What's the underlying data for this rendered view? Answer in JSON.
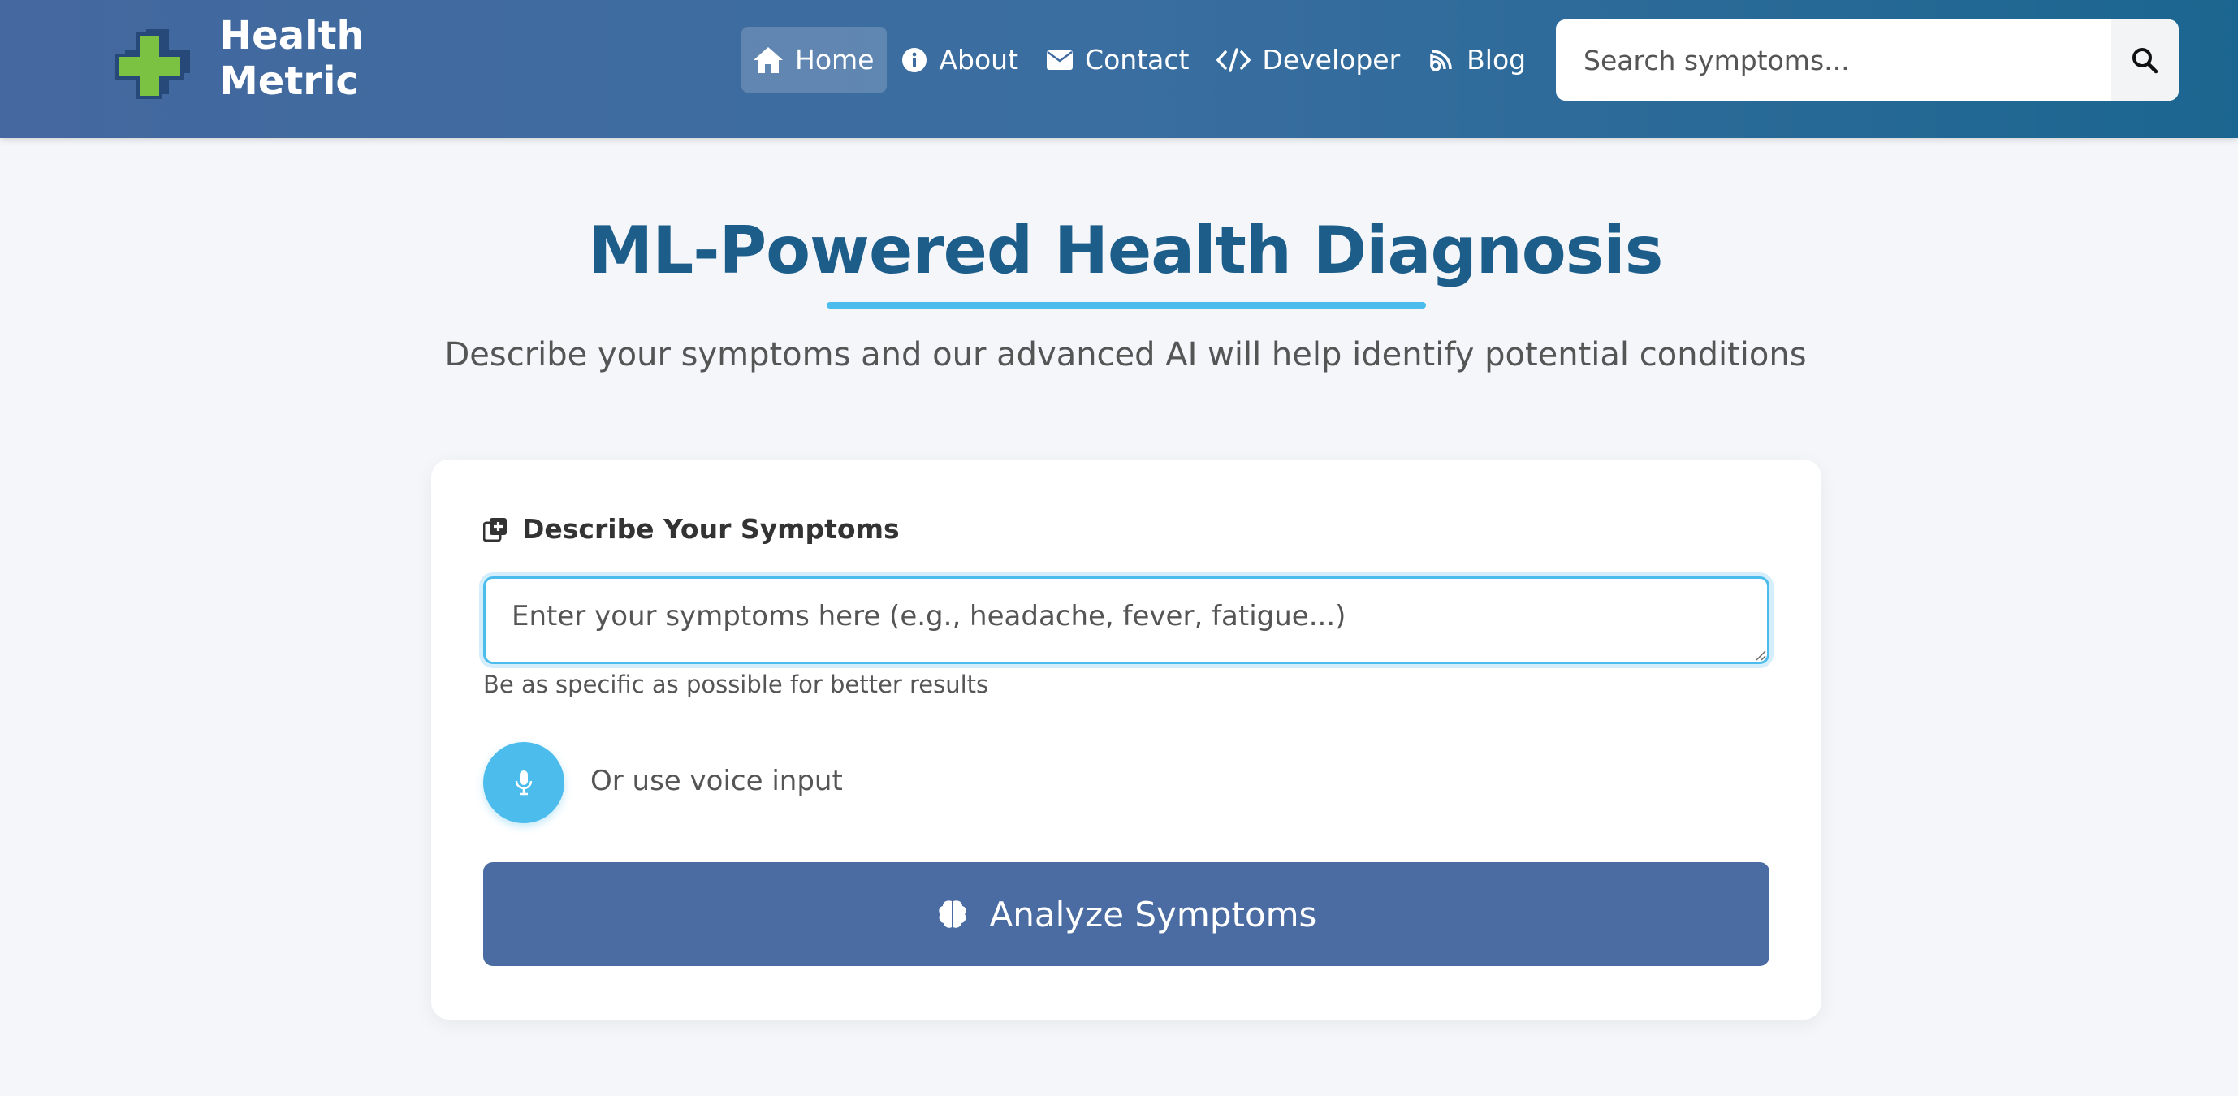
{
  "header": {
    "brand_line1": "Health",
    "brand_line2": "Metric",
    "nav": [
      {
        "label": "Home",
        "icon": "home-icon",
        "active": true
      },
      {
        "label": "About",
        "icon": "info-icon"
      },
      {
        "label": "Contact",
        "icon": "envelope-icon"
      },
      {
        "label": "Developer",
        "icon": "code-icon"
      },
      {
        "label": "Blog",
        "icon": "blog-icon"
      }
    ],
    "search": {
      "placeholder": "Search symptoms...",
      "icon": "search-icon"
    }
  },
  "hero": {
    "title": "ML-Powered Health Diagnosis",
    "subtitle": "Describe your symptoms and our advanced AI will help identify potential conditions"
  },
  "form": {
    "label": "Describe Your Symptoms",
    "label_icon": "notes-medical-icon",
    "input_placeholder": "Enter your symptoms here (e.g., headache, fever, fatigue...)",
    "hint": "Be as specific as possible for better results",
    "voice_label": "Or use voice input",
    "mic_icon": "microphone-icon",
    "analyze_label": "Analyze Symptoms",
    "analyze_icon": "brain-icon"
  },
  "colors": {
    "header_start": "#44689f",
    "header_end": "#1b6690",
    "accent": "#4cbcec",
    "title": "#1d5d8a",
    "button": "#4a6ca2",
    "logo_green": "#7cc242"
  }
}
